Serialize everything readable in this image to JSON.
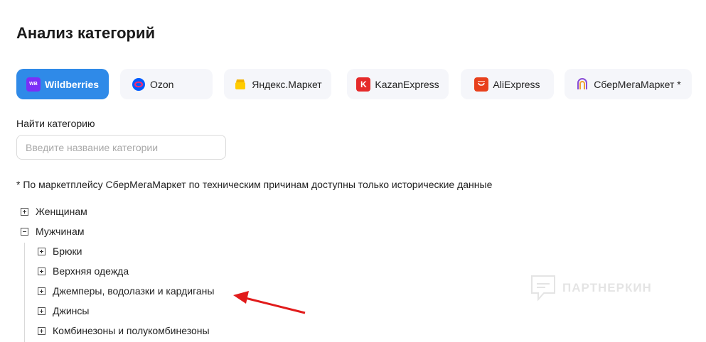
{
  "page": {
    "title": "Анализ категорий"
  },
  "marketplaces": [
    {
      "label": "Wildberries",
      "icon": "wb-icon",
      "icon_text": "WB",
      "color": "#7b2ff7",
      "active": true
    },
    {
      "label": "Ozon",
      "icon": "ozon-icon",
      "color": "#005bff",
      "active": false
    },
    {
      "label": "Яндекс.Маркет",
      "icon": "yandex-market-icon",
      "color": "#ffcc00",
      "active": false
    },
    {
      "label": "KazanExpress",
      "icon": "kazanexpress-icon",
      "icon_text": "K",
      "color": "#e52a2a",
      "active": false
    },
    {
      "label": "AliExpress",
      "icon": "aliexpress-icon",
      "color": "#e8401c",
      "active": false
    },
    {
      "label": "СберМегаМаркет *",
      "icon": "sbermegamarket-icon",
      "active": false
    }
  ],
  "search": {
    "label": "Найти категорию",
    "placeholder": "Введите название категории",
    "value": ""
  },
  "note": "* По маркетплейсу СберМегаМаркет по техническим причинам доступны только исторические данные",
  "tree": [
    {
      "label": "Женщинам",
      "expanded": false,
      "level": 0
    },
    {
      "label": "Мужчинам",
      "expanded": true,
      "level": 0
    },
    {
      "label": "Брюки",
      "expanded": false,
      "level": 1
    },
    {
      "label": "Верхняя одежда",
      "expanded": false,
      "level": 1
    },
    {
      "label": "Джемперы, водолазки и кардиганы",
      "expanded": false,
      "level": 1
    },
    {
      "label": "Джинсы",
      "expanded": false,
      "level": 1
    },
    {
      "label": "Комбинезоны и полукомбинезоны",
      "expanded": false,
      "level": 1
    }
  ],
  "watermark": "ПАРТНЕРКИН",
  "colors": {
    "accent": "#2f8ae8",
    "arrow": "#e11b1b"
  }
}
